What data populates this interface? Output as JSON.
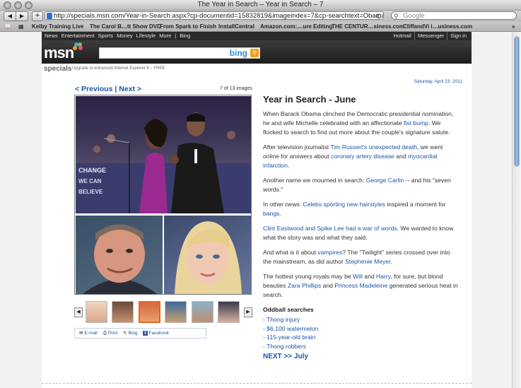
{
  "window": {
    "title": "The Year in Search – Year in Search – 7"
  },
  "toolbar": {
    "url": "http://specials.msn.com/Year-in-Search.aspx?cp-documentid=15832819&imageindex=7&cp-searchtext=Obama%20fist%2",
    "search_placeholder": "Google",
    "back": "◀",
    "forward": "▶",
    "add": "+",
    "reload": "C"
  },
  "bookmarks": [
    "Kelby Training Live",
    "The Carol B…tt Show DVD",
    "From Spark to Finish",
    "InstallCentral",
    "Amazon.com:…ure Editing",
    "THE CENTUR…siness.com",
    "CliffandVi i…usiness.com"
  ],
  "msn": {
    "nav_left": [
      "News",
      "Entertainment",
      "Sports",
      "Money",
      "Lifestyle",
      "More",
      "|",
      "Bing"
    ],
    "nav_right": [
      "Hotmail",
      "Messenger",
      "Sign in"
    ],
    "logo": "msn",
    "bing": "bing",
    "specials": "specials",
    "upgrade": "Upgrade to enhanced Internet Explorer 9 – FREE"
  },
  "gallery": {
    "date": "Saturday, April 23, 2011",
    "prev": "< Previous",
    "next": "Next >",
    "counter": "7 of 13 images",
    "share": [
      "E-mail",
      "Print",
      "Blog",
      "Facebook"
    ]
  },
  "article": {
    "headline": "Year in Search - June",
    "p1_a": "When Barack Obama clinched the Democratic presidential nomination, he and wife Michelle celebrated with an affectionate ",
    "p1_link": "fist bump",
    "p1_b": ". We flocked to search to find out more about the couple's signature salute.",
    "p2_a": "After television journalist ",
    "p2_link1": "Tim Russert's unexpected death",
    "p2_b": ", we went online for answers about ",
    "p2_link2": "coronary artery disease",
    "p2_c": " and ",
    "p2_link3": "myocardial infarction",
    "p2_d": ".",
    "p3_a": "Another name we mourned in search: ",
    "p3_link": "George Carlin",
    "p3_b": " -- and his \"seven words.\"",
    "p4_a": "In other news: ",
    "p4_link1": "Celebs sporting new hairstyles",
    "p4_b": " inspired a moment for ",
    "p4_link2": "bangs",
    "p4_c": ".",
    "p5_link": "Clint Eastwood and Spike Lee had a war of words",
    "p5_b": ". We wanted to know what the story was and what they said.",
    "p6_a": "And what is it about ",
    "p6_link1": "vampires",
    "p6_b": "? The \"Twilight\" series crossed over into the mainstream, as did author ",
    "p6_link2": "Stephenie Meyer",
    "p6_c": ".",
    "p7_a": "The hottest young royals may be ",
    "p7_link1": "Will",
    "p7_b": " and ",
    "p7_link2": "Harry",
    "p7_c": ", for sure, but blond beauties ",
    "p7_link3": "Zara Phillips",
    "p7_d": " and ",
    "p7_link4": "Princess Madeleine",
    "p7_e": " generated serious heat in search.",
    "oddball_title": "Oddball searches",
    "oddball": [
      "- Thong injury",
      "- $6,100 watermelon",
      "- 115-year-old brain",
      "- Thong robbers"
    ],
    "next_link": "NEXT >> July"
  }
}
